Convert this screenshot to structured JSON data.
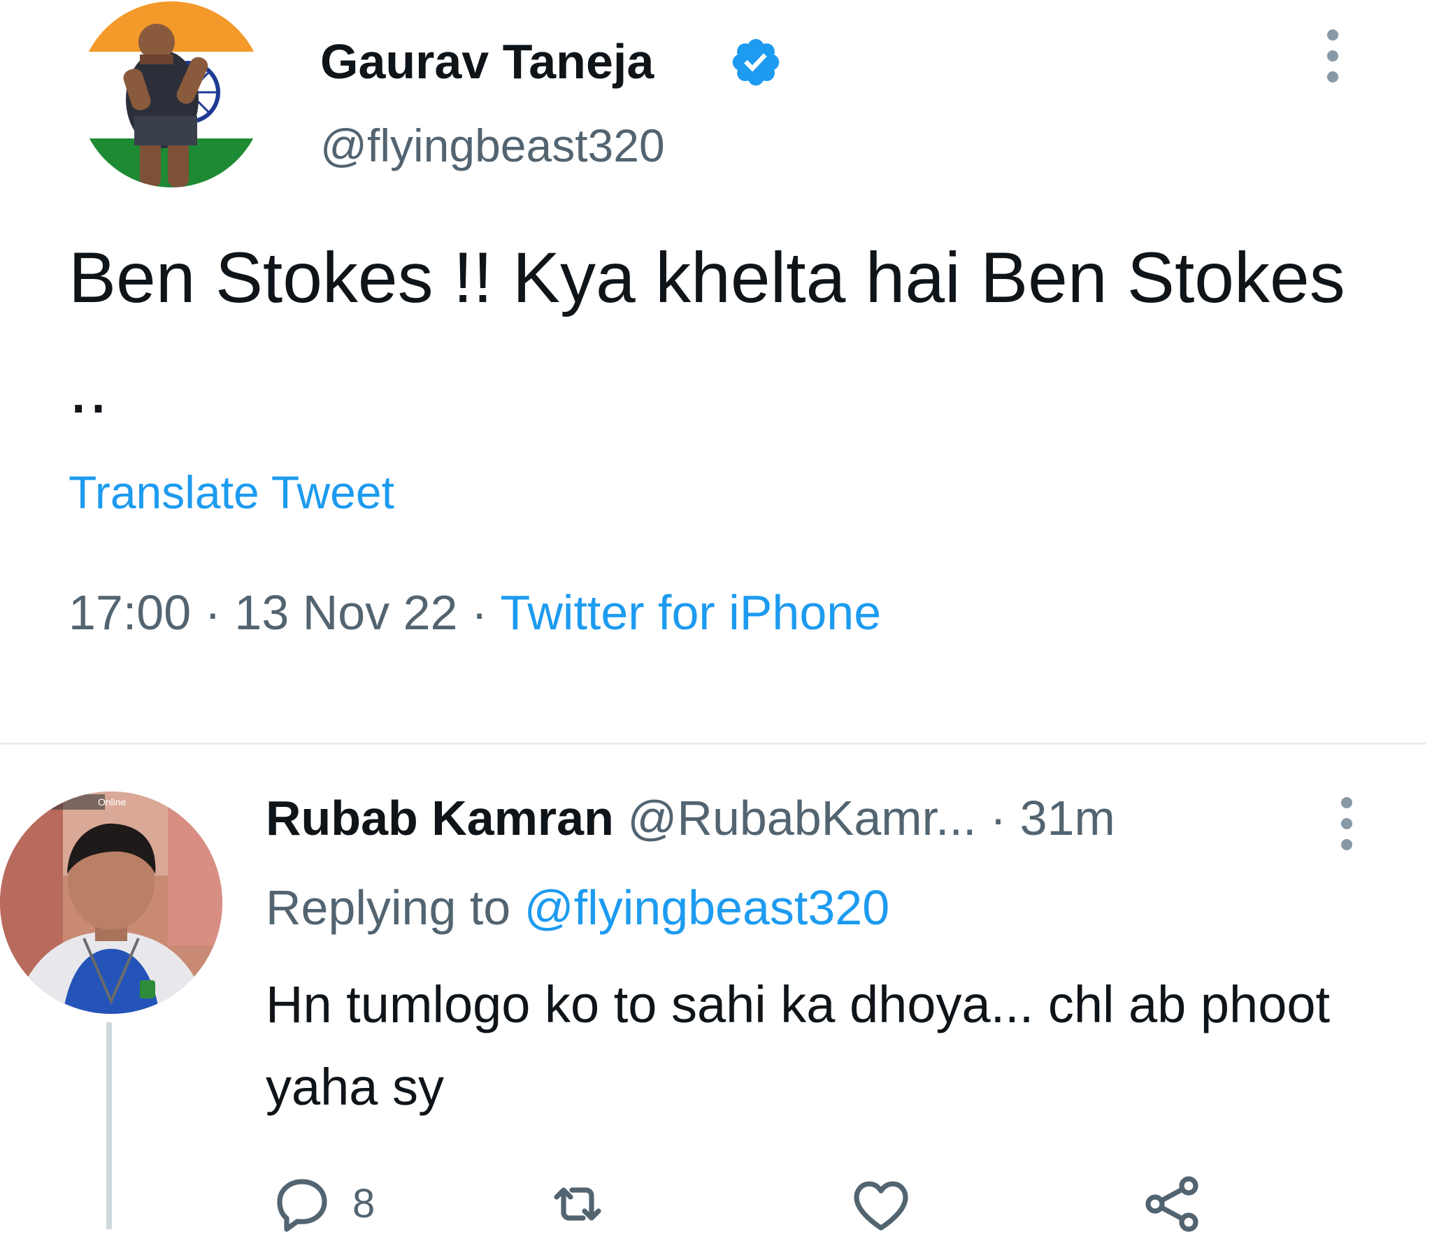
{
  "tweet": {
    "author_name": "Gaurav Taneja",
    "author_handle": "@flyingbeast320",
    "text": "Ben Stokes !! Kya khelta hai Ben Stokes ..",
    "translate_label": "Translate Tweet",
    "time": "17:00",
    "sep1": " · ",
    "date": "13 Nov 22",
    "sep2": " · ",
    "source": "Twitter for iPhone",
    "verified_icon": "verified-badge-icon",
    "more_icon": "more-vertical-icon"
  },
  "reply": {
    "author_name": "Rubab Kamran",
    "author_handle": "@RubabKamr...",
    "dot": " · ",
    "time": "31m",
    "replying_prefix": "Replying to ",
    "replying_to": "@flyingbeast320",
    "text": "Hn tumlogo ko to sahi ka dhoya... chl ab phoot yaha sy",
    "avatar_overlay_text": "Online",
    "actions": {
      "reply_count": "8",
      "reply_icon": "reply-icon",
      "retweet_icon": "retweet-icon",
      "like_icon": "heart-icon",
      "share_icon": "share-icon"
    }
  },
  "colors": {
    "accent": "#1d9bf0",
    "text_primary": "#0f1419",
    "text_secondary": "#536471",
    "divider": "#e6ecf0"
  }
}
